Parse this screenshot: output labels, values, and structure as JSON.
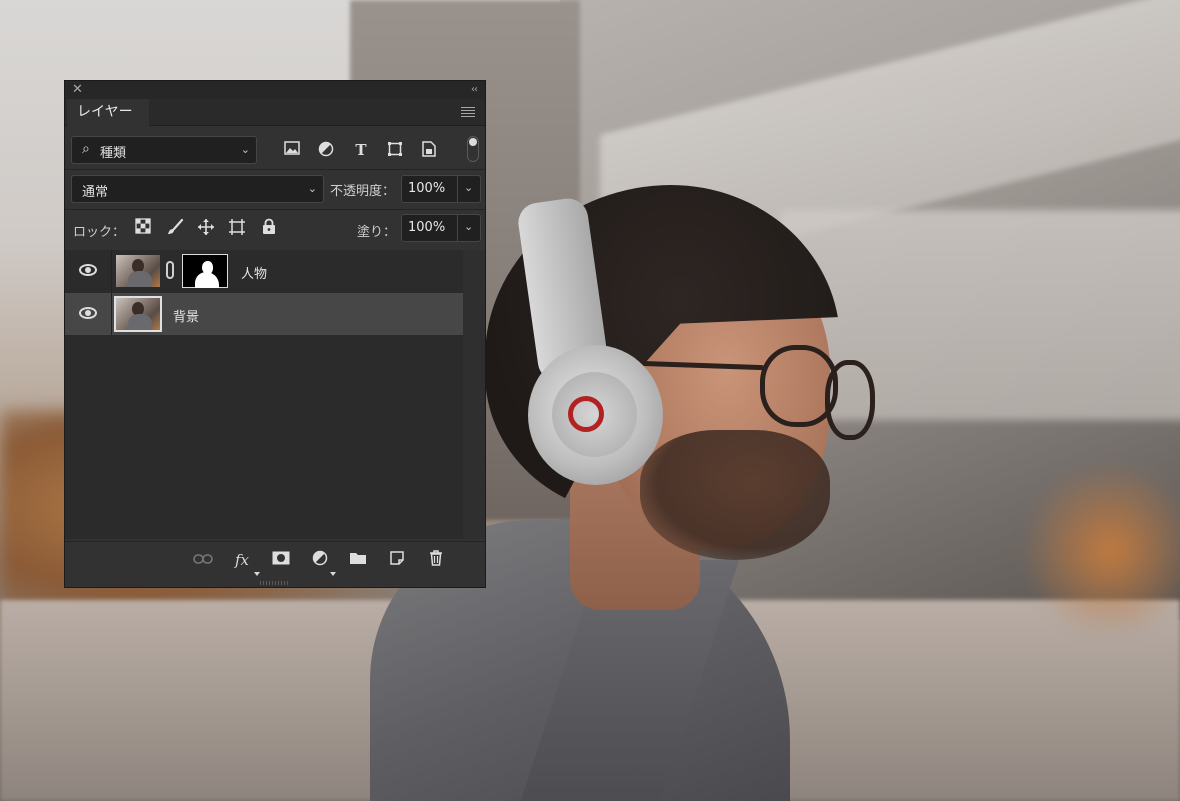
{
  "panel": {
    "tab_label": "レイヤー",
    "close_glyph": "✕",
    "collapse_glyph": "‹‹",
    "filter": {
      "label": "種類",
      "selected": "種類"
    },
    "blend_mode": "通常",
    "opacity_label": "不透明度：",
    "opacity_value": "100%",
    "lock_label": "ロック：",
    "fill_label": "塗り：",
    "fill_value": "100%",
    "layers": [
      {
        "name": "人物",
        "visible": true,
        "has_mask": true,
        "selected": false
      },
      {
        "name": "背景",
        "visible": true,
        "has_mask": false,
        "selected": true
      }
    ],
    "filter_icons": [
      "image-filter-icon",
      "adjustment-filter-icon",
      "type-filter-icon",
      "shape-filter-icon",
      "smart-object-filter-icon"
    ],
    "lock_icons": [
      "lock-transparent-pixels-icon",
      "lock-image-pixels-icon",
      "lock-position-icon",
      "lock-artboard-icon",
      "lock-all-icon"
    ],
    "bottom_icons": [
      "link-layers-icon",
      "fx-icon",
      "add-mask-icon",
      "new-adjustment-layer-icon",
      "new-group-icon",
      "new-layer-icon",
      "delete-layer-icon"
    ],
    "colors": {
      "panel_bg": "#323232",
      "selected_row": "#474747",
      "text": "#d6d6d6"
    }
  }
}
